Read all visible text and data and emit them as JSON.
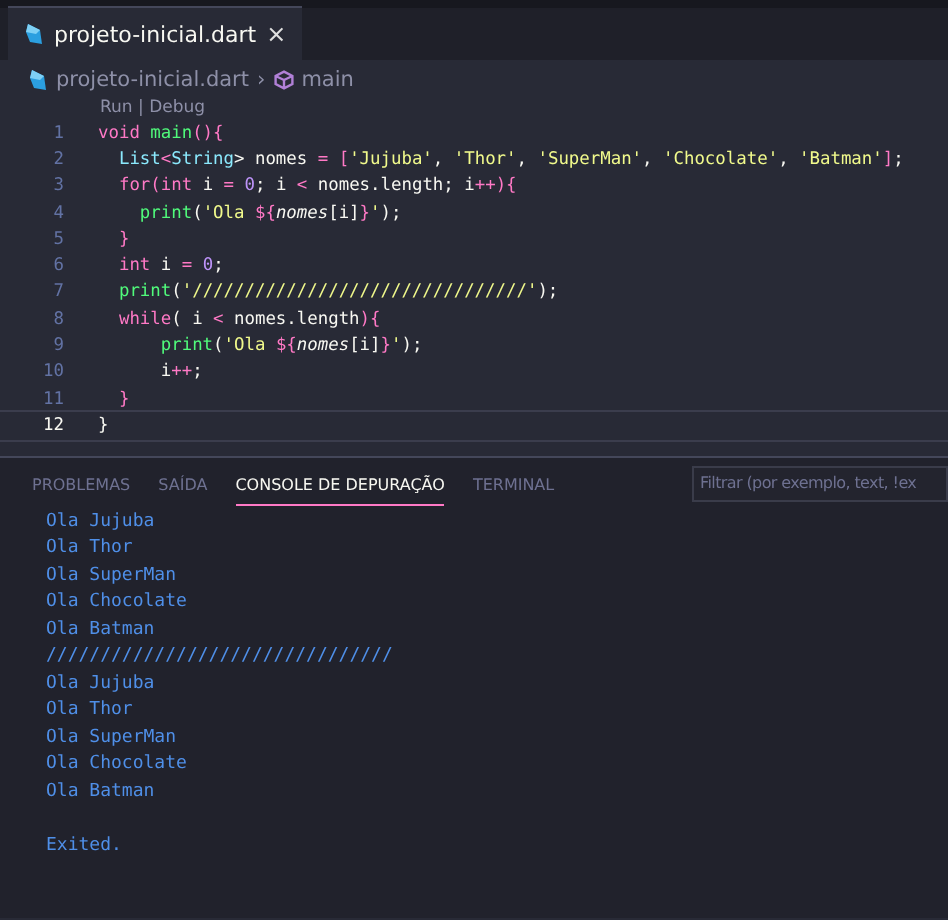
{
  "editor_tabs": [
    {
      "label": "projeto-inicial.dart",
      "close": "×",
      "selected": true
    }
  ],
  "breadcrumb": {
    "file": "projeto-inicial.dart",
    "separator": "›",
    "symbol": "main"
  },
  "codelens": "Run | Debug",
  "lines": [
    {
      "number": "1",
      "current": false,
      "tokens": [
        {
          "t": "void ",
          "kind": "kw"
        },
        {
          "t": "main",
          "kind": "fn"
        },
        {
          "t": "(){",
          "kind": "brace"
        }
      ]
    },
    {
      "number": "2",
      "current": false,
      "tokens": [
        {
          "t": "  List",
          "kind": "type"
        },
        {
          "t": "<",
          "kind": "op"
        },
        {
          "t": "String",
          "kind": "type"
        },
        {
          "t": "> nomes ",
          "kind": "plain"
        },
        {
          "t": "= ",
          "kind": "op"
        },
        {
          "t": "[",
          "kind": "brace"
        },
        {
          "t": "'Jujuba'",
          "kind": "str"
        },
        {
          "t": ", ",
          "kind": "plain"
        },
        {
          "t": "'Thor'",
          "kind": "str"
        },
        {
          "t": ", ",
          "kind": "plain"
        },
        {
          "t": "'SuperMan'",
          "kind": "str"
        },
        {
          "t": ", ",
          "kind": "plain"
        },
        {
          "t": "'Chocolate'",
          "kind": "str"
        },
        {
          "t": ", ",
          "kind": "plain"
        },
        {
          "t": "'Batman'",
          "kind": "str"
        },
        {
          "t": "]",
          "kind": "brace"
        },
        {
          "t": ";",
          "kind": "plain"
        }
      ]
    },
    {
      "number": "3",
      "current": false,
      "tokens": [
        {
          "t": "  for",
          "kind": "kw"
        },
        {
          "t": "(",
          "kind": "brace"
        },
        {
          "t": "int",
          "kind": "kw"
        },
        {
          "t": " i ",
          "kind": "plain"
        },
        {
          "t": "= ",
          "kind": "op"
        },
        {
          "t": "0",
          "kind": "num"
        },
        {
          "t": "; i ",
          "kind": "plain"
        },
        {
          "t": "<",
          "kind": "op"
        },
        {
          "t": " nomes.length; i",
          "kind": "plain"
        },
        {
          "t": "++",
          "kind": "op"
        },
        {
          "t": "){",
          "kind": "brace"
        }
      ]
    },
    {
      "number": "4",
      "current": false,
      "tokens": [
        {
          "t": "    print",
          "kind": "fn"
        },
        {
          "t": "(",
          "kind": "plain"
        },
        {
          "t": "'Ola ",
          "kind": "str"
        },
        {
          "t": "${",
          "kind": "interp"
        },
        {
          "t": "nomes",
          "kind": "var"
        },
        {
          "t": "[i]",
          "kind": "plain"
        },
        {
          "t": "}",
          "kind": "interp"
        },
        {
          "t": "'",
          "kind": "str"
        },
        {
          "t": ");",
          "kind": "plain"
        }
      ]
    },
    {
      "number": "5",
      "current": false,
      "tokens": [
        {
          "t": "  }",
          "kind": "brace"
        }
      ]
    },
    {
      "number": "6",
      "current": false,
      "tokens": [
        {
          "t": "  int",
          "kind": "kw"
        },
        {
          "t": " i ",
          "kind": "plain"
        },
        {
          "t": "= ",
          "kind": "op"
        },
        {
          "t": "0",
          "kind": "num"
        },
        {
          "t": ";",
          "kind": "plain"
        }
      ]
    },
    {
      "number": "7",
      "current": false,
      "tokens": [
        {
          "t": "  print",
          "kind": "fn"
        },
        {
          "t": "(",
          "kind": "plain"
        },
        {
          "t": "'////////////////////////////////'",
          "kind": "str"
        },
        {
          "t": ");",
          "kind": "plain"
        }
      ]
    },
    {
      "number": "8",
      "current": false,
      "tokens": [
        {
          "t": "  while",
          "kind": "kw"
        },
        {
          "t": "( i ",
          "kind": "plain"
        },
        {
          "t": "<",
          "kind": "op"
        },
        {
          "t": " nomes.length",
          "kind": "plain"
        },
        {
          "t": "){",
          "kind": "brace"
        }
      ]
    },
    {
      "number": "9",
      "current": false,
      "tokens": [
        {
          "t": "      print",
          "kind": "fn"
        },
        {
          "t": "(",
          "kind": "plain"
        },
        {
          "t": "'Ola ",
          "kind": "str"
        },
        {
          "t": "${",
          "kind": "interp"
        },
        {
          "t": "nomes",
          "kind": "var"
        },
        {
          "t": "[i]",
          "kind": "plain"
        },
        {
          "t": "}",
          "kind": "interp"
        },
        {
          "t": "'",
          "kind": "str"
        },
        {
          "t": ");",
          "kind": "plain"
        }
      ]
    },
    {
      "number": "10",
      "current": false,
      "tokens": [
        {
          "t": "      i",
          "kind": "plain"
        },
        {
          "t": "++",
          "kind": "op"
        },
        {
          "t": ";",
          "kind": "plain"
        }
      ]
    },
    {
      "number": "11",
      "current": false,
      "tokens": [
        {
          "t": "  }",
          "kind": "brace"
        }
      ]
    },
    {
      "number": "12",
      "current": true,
      "tokens": [
        {
          "t": "}",
          "kind": "plain"
        }
      ]
    }
  ],
  "panel": {
    "tabs": [
      {
        "label": "PROBLEMAS",
        "selected": false
      },
      {
        "label": "SAÍDA",
        "selected": false
      },
      {
        "label": "CONSOLE DE DEPURAÇÃO",
        "selected": true
      },
      {
        "label": "TERMINAL",
        "selected": false
      }
    ],
    "filter": {
      "placeholder": "Filtrar (por exemplo, text, !ex"
    },
    "output": [
      {
        "text": "Ola Jujuba",
        "kind": "line"
      },
      {
        "text": "Ola Thor",
        "kind": "line"
      },
      {
        "text": "Ola SuperMan",
        "kind": "line"
      },
      {
        "text": "Ola Chocolate",
        "kind": "line"
      },
      {
        "text": "Ola Batman",
        "kind": "line"
      },
      {
        "text": "////////////////////////////////",
        "kind": "line"
      },
      {
        "text": "Ola Jujuba",
        "kind": "line"
      },
      {
        "text": "Ola Thor",
        "kind": "line"
      },
      {
        "text": "Ola SuperMan",
        "kind": "line"
      },
      {
        "text": "Ola Chocolate",
        "kind": "line"
      },
      {
        "text": "Ola Batman",
        "kind": "line"
      },
      {
        "text": "Exited.",
        "kind": "status"
      }
    ]
  }
}
